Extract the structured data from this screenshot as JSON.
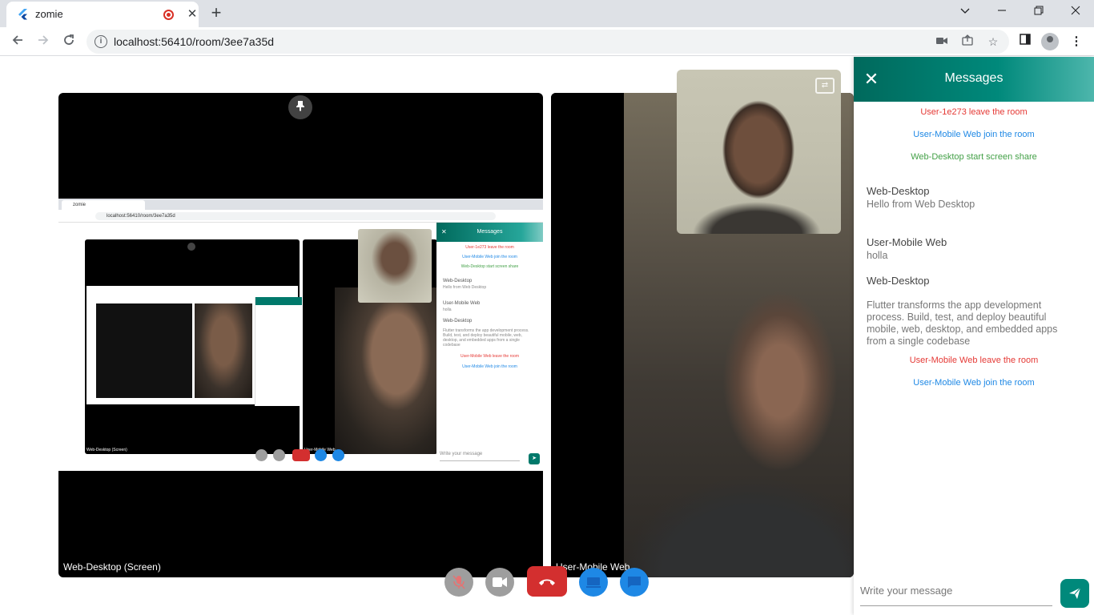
{
  "browser": {
    "tab_title": "zomie",
    "tab_close": "✕",
    "new_tab": "+",
    "url": "localhost:56410/room/3ee7a35d",
    "icons": [
      "chevron-down-icon",
      "minimize-icon",
      "restore-icon",
      "close-icon",
      "back-icon",
      "forward-icon",
      "reload-icon",
      "info-icon",
      "camera-icon",
      "share-icon",
      "star-icon",
      "sidepanel-icon",
      "profile-icon",
      "menu-icon"
    ]
  },
  "tiles": {
    "screen_label": "Web-Desktop (Screen)",
    "camera_label": "User-Mobile Web"
  },
  "nested": {
    "tab_title": "zomie",
    "url": "localhost:56410/room/3ee7a35d",
    "panel_title": "Messages",
    "events": [
      {
        "text": "User-1e273 leave the room",
        "color": "red"
      },
      {
        "text": "User-Mobile Web join the room",
        "color": "blue"
      },
      {
        "text": "Web-Desktop start screen share",
        "color": "green"
      }
    ],
    "messages": [
      {
        "sender": "Web-Desktop",
        "text": "Hello from Web Desktop"
      },
      {
        "sender": "User-Mobile Web",
        "text": "holla"
      },
      {
        "sender": "Web-Desktop",
        "text": "Flutter transforms the app development process. Build, test, and deploy beautiful mobile, web, desktop, and embedded apps from a single codebase"
      }
    ],
    "events_after": [
      {
        "text": "User-Mobile Web leave the room",
        "color": "red"
      },
      {
        "text": "User-Mobile Web join the room",
        "color": "blue"
      }
    ],
    "input_placeholder": "Write your message",
    "tile_label_screen": "Web-Desktop (Screen)",
    "tile_label_camera": "User-Mobile Web"
  },
  "controls": {
    "mic": "mic-off-icon",
    "camera": "videocam-icon",
    "end_call": "call-end-icon",
    "screen_share": "screen-share-icon",
    "chat": "chat-icon"
  },
  "messages_panel": {
    "title": "Messages",
    "close": "✕",
    "events": [
      {
        "text": "User-1e273 leave the room",
        "color": "red"
      },
      {
        "text": "User-Mobile Web join the room",
        "color": "blue"
      },
      {
        "text": "Web-Desktop start screen share",
        "color": "green"
      }
    ],
    "messages": [
      {
        "sender": "Web-Desktop",
        "text": "Hello from Web Desktop"
      },
      {
        "sender": "User-Mobile Web",
        "text": "holla"
      },
      {
        "sender": "Web-Desktop",
        "text": "Flutter transforms the app development process. Build, test, and deploy beautiful mobile, web, desktop, and embedded apps from a single codebase"
      }
    ],
    "events_after": [
      {
        "text": "User-Mobile Web leave the room",
        "color": "red"
      },
      {
        "text": "User-Mobile Web join the room",
        "color": "blue"
      }
    ],
    "input_placeholder": "Write your message"
  },
  "colors": {
    "accent": "#00897b",
    "end_call": "#d32f2f",
    "event_red": "#e53935",
    "event_blue": "#1e88e5",
    "event_green": "#43a047"
  }
}
